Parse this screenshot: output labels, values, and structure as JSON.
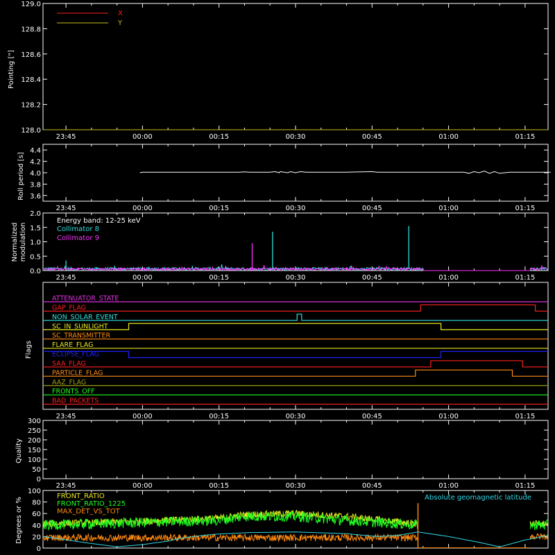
{
  "colors": {
    "background": "#000000",
    "frame": "#ffffff",
    "x_series": "#ff2020",
    "y_series": "#c8c020",
    "collimator8": "#30e0e0",
    "collimator9": "#ff30ff",
    "front_ratio": "#e8e820",
    "front_ratio_1225": "#20ff20",
    "max_det": "#ff8a10",
    "geomag": "#30d8e8"
  },
  "time_axis": {
    "tick_labels": [
      "23:45",
      "00:00",
      "00:15",
      "00:30",
      "00:45",
      "01:00",
      "01:15"
    ],
    "tick_minutes": [
      -15,
      0,
      15,
      30,
      45,
      60,
      75
    ],
    "range_minutes": [
      -19.5,
      79.5
    ]
  },
  "chart_data": [
    {
      "type": "line",
      "id": "pointing",
      "ylabel": "Pointing [\"]",
      "ylim": [
        128.0,
        129.0
      ],
      "y_ticks": [
        "128.0",
        "128.2",
        "128.4",
        "128.6",
        "128.8",
        "129.0"
      ],
      "y_tick_values": [
        128.0,
        128.2,
        128.4,
        128.6,
        128.8,
        129.0
      ],
      "series": [
        {
          "name": "X",
          "color": "#ff2020",
          "x": [],
          "values": []
        },
        {
          "name": "Y",
          "color": "#c8c020",
          "x": [],
          "values": []
        }
      ]
    },
    {
      "type": "line",
      "id": "roll",
      "ylabel": "Roll period [s]",
      "ylim": [
        3.5,
        4.5
      ],
      "y_ticks": [
        "3.6",
        "3.8",
        "4.0",
        "4.2",
        "4.4"
      ],
      "y_tick_values": [
        3.6,
        3.8,
        4.0,
        4.2,
        4.4
      ],
      "series": [
        {
          "name": "",
          "color": "#ffffff",
          "x": [
            -0.5,
            0,
            10,
            19,
            20,
            21,
            25,
            26,
            26.8,
            27,
            28.5,
            29,
            30,
            31,
            32,
            40,
            45,
            46,
            55,
            63,
            64,
            65,
            66,
            67,
            68,
            69,
            70,
            71,
            72,
            80
          ],
          "values": [
            4.0,
            4.01,
            4.01,
            4.01,
            4.015,
            4.01,
            4.01,
            4.02,
            4.0,
            4.02,
            4.0,
            4.02,
            4.0,
            4.02,
            4.01,
            4.01,
            4.02,
            4.01,
            4.01,
            4.01,
            3.99,
            4.02,
            4.0,
            4.03,
            3.99,
            4.02,
            3.99,
            4.0,
            4.01,
            4.01
          ]
        }
      ]
    },
    {
      "type": "line",
      "id": "modulation",
      "ylabel": "Normalized modulation",
      "ylim": [
        0,
        2.0
      ],
      "y_ticks": [
        "0.0",
        "0.5",
        "1.0",
        "1.5",
        "2.0"
      ],
      "y_tick_values": [
        0,
        0.5,
        1.0,
        1.5,
        2.0
      ],
      "annotation": "Energy band: 12-25 keV",
      "series": [
        {
          "name": "Collimator 8",
          "color": "#30e0e0",
          "baseline": 0.06,
          "noise": 0.05,
          "x_range": [
            -19.5,
            55
          ],
          "x_range2": [
            76,
            79.5
          ],
          "spikes": [
            {
              "x": -15,
              "v": 0.35
            },
            {
              "x": 5,
              "v": 0.12
            },
            {
              "x": 25.5,
              "v": 1.35
            },
            {
              "x": 52.2,
              "v": 1.55
            }
          ]
        },
        {
          "name": "Collimator 9",
          "color": "#ff30ff",
          "baseline": 0.05,
          "noise": 0.04,
          "x_range": [
            -19.5,
            55
          ],
          "x_range2": [
            76,
            79.5
          ],
          "spikes": [
            {
              "x": 21.5,
              "v": 0.95
            },
            {
              "x": 40,
              "v": 0.12
            }
          ]
        }
      ]
    },
    {
      "type": "line",
      "id": "flags",
      "ylabel": "Flags",
      "flags": [
        {
          "label": "ATTENUATOR_STATE",
          "color": "#e030e0",
          "steps": [
            [
              -19.5,
              0
            ]
          ]
        },
        {
          "label": "GAP_FLAG",
          "color": "#ff2020",
          "steps": [
            [
              -19.5,
              0
            ],
            [
              54.5,
              1
            ],
            [
              77,
              0
            ]
          ]
        },
        {
          "label": "NON_SOLAR_EVENT",
          "color": "#30e0e0",
          "steps": [
            [
              -19.5,
              0
            ],
            [
              30.3,
              1
            ],
            [
              31.2,
              0
            ]
          ]
        },
        {
          "label": "SC_IN_SUNLIGHT",
          "color": "#e8e820",
          "steps": [
            [
              -19.5,
              0
            ],
            [
              -2.7,
              1
            ],
            [
              58.5,
              0
            ]
          ]
        },
        {
          "label": "SC_TRANSMITTER",
          "color": "#ff8a10",
          "steps": [
            [
              -19.5,
              0
            ]
          ]
        },
        {
          "label": "FLARE_FLAG",
          "color": "#e8e820",
          "steps": [
            [
              -19.5,
              0
            ]
          ]
        },
        {
          "label": "ECLIPSE_FLAG",
          "color": "#2020ff",
          "steps": [
            [
              -19.5,
              1
            ],
            [
              -2.7,
              0
            ],
            [
              58.5,
              1
            ]
          ]
        },
        {
          "label": "SAA_FLAG",
          "color": "#ff2020",
          "steps": [
            [
              -19.5,
              0
            ],
            [
              56.5,
              1
            ],
            [
              74.5,
              0
            ]
          ]
        },
        {
          "label": "PARTICLE_FLAG",
          "color": "#ff8a10",
          "steps": [
            [
              -19.5,
              0
            ],
            [
              53.5,
              1
            ],
            [
              72.5,
              0
            ]
          ]
        },
        {
          "label": "AAZ_FLAG",
          "color": "#a0a010",
          "steps": [
            [
              -19.5,
              0
            ]
          ]
        },
        {
          "label": "FRONTS_OFF",
          "color": "#20ff20",
          "steps": [
            [
              -19.5,
              0
            ]
          ]
        },
        {
          "label": "BAD_PACKETS",
          "color": "#ff2020",
          "steps": [
            [
              -19.5,
              0
            ]
          ]
        }
      ]
    },
    {
      "type": "line",
      "id": "quality",
      "ylabel": "Quality",
      "ylim": [
        0,
        300
      ],
      "y_ticks": [
        "0",
        "50",
        "100",
        "150",
        "200",
        "250",
        "300"
      ],
      "y_tick_values": [
        0,
        50,
        100,
        150,
        200,
        250,
        300
      ],
      "series": []
    },
    {
      "type": "line",
      "id": "ratios",
      "ylabel": "Degrees or %",
      "ylim": [
        0,
        100
      ],
      "y_ticks": [
        "0",
        "20",
        "40",
        "60",
        "80",
        "100"
      ],
      "y_tick_values": [
        0,
        20,
        40,
        60,
        80,
        100
      ],
      "series": [
        {
          "name": "FRONT_RATIO",
          "color": "#e8e820",
          "x_range": [
            -19.5,
            54
          ],
          "x_range2": [
            76,
            79.5
          ],
          "trend_x": [
            -19.5,
            -5,
            15,
            20,
            30,
            40,
            54
          ],
          "trend_y": [
            42,
            45,
            52,
            58,
            60,
            55,
            42
          ],
          "noise": 6
        },
        {
          "name": "FRONT_RATIO_1225",
          "color": "#20ff20",
          "x_range": [
            -19.5,
            54
          ],
          "x_range2": [
            76,
            79.5
          ],
          "trend_x": [
            -19.5,
            -5,
            15,
            20,
            30,
            40,
            54
          ],
          "trend_y": [
            40,
            43,
            48,
            55,
            55,
            48,
            40
          ],
          "noise": 9
        },
        {
          "name": "MAX_DET_VS_TOT",
          "color": "#ff8a10",
          "x_range": [
            -19.5,
            54
          ],
          "x_range2": [
            76,
            79.5
          ],
          "trend_x": [
            -19.5,
            54
          ],
          "trend_y": [
            18,
            18
          ],
          "noise": 6,
          "spike": {
            "x": 54,
            "v": 78
          }
        },
        {
          "name": "Absolute geomagnetic latitude",
          "color": "#30d8e8",
          "x": [
            -19.5,
            -10,
            -5,
            0,
            5,
            8,
            14,
            21,
            30,
            40,
            46,
            50,
            54,
            60,
            66,
            70,
            75,
            79.5
          ],
          "values": [
            20,
            8,
            2,
            6,
            12,
            18,
            24,
            27,
            28,
            25,
            20,
            22,
            28,
            20,
            10,
            2,
            14,
            22
          ]
        }
      ]
    }
  ]
}
